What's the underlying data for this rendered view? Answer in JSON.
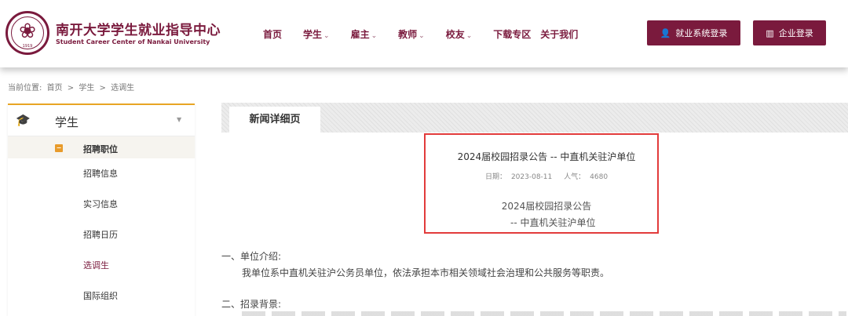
{
  "header": {
    "logo_caption": "1919",
    "brand_cn": "南开大学学生就业指导中心",
    "brand_en": "Student Career Center of Nankai University",
    "nav": [
      {
        "label": "首页",
        "dropdown": false
      },
      {
        "label": "学生",
        "dropdown": true
      },
      {
        "label": "雇主",
        "dropdown": true
      },
      {
        "label": "教师",
        "dropdown": true
      },
      {
        "label": "校友",
        "dropdown": true
      },
      {
        "label": "下载专区",
        "dropdown": false
      },
      {
        "label": "关于我们",
        "dropdown": false
      }
    ],
    "student_login": "就业系统登录",
    "company_login": "企业登录"
  },
  "breadcrumb": {
    "prefix": "当前位置:",
    "items": [
      "首页",
      ">",
      "学生",
      ">",
      "选调生"
    ]
  },
  "sidebar": {
    "title": "学生",
    "category": "招聘职位",
    "items": [
      "招聘信息",
      "实习信息",
      "招聘日历",
      "选调生",
      "国际组织"
    ],
    "active_item": "选调生"
  },
  "content": {
    "tab": "新闻详细页",
    "title": "2024届校园招录公告 -- 中直机关驻沪单位",
    "date_label": "日期：",
    "date": "2023-08-11",
    "views_label": "人气：",
    "views": "4680",
    "subtitle1": "2024届校园招录公告",
    "subtitle2": "-- 中直机关驻沪单位",
    "section1_heading": "一、单位介绍:",
    "section1_text": "我单位系中直机关驻沪公务员单位，依法承担本市相关领域社会治理和公共服务等职责。",
    "section2_heading": "二、招录背景:"
  },
  "colors": {
    "brand": "#7a1a3d",
    "accent_orange": "#e8a524",
    "highlight_red": "#e23b3b"
  }
}
